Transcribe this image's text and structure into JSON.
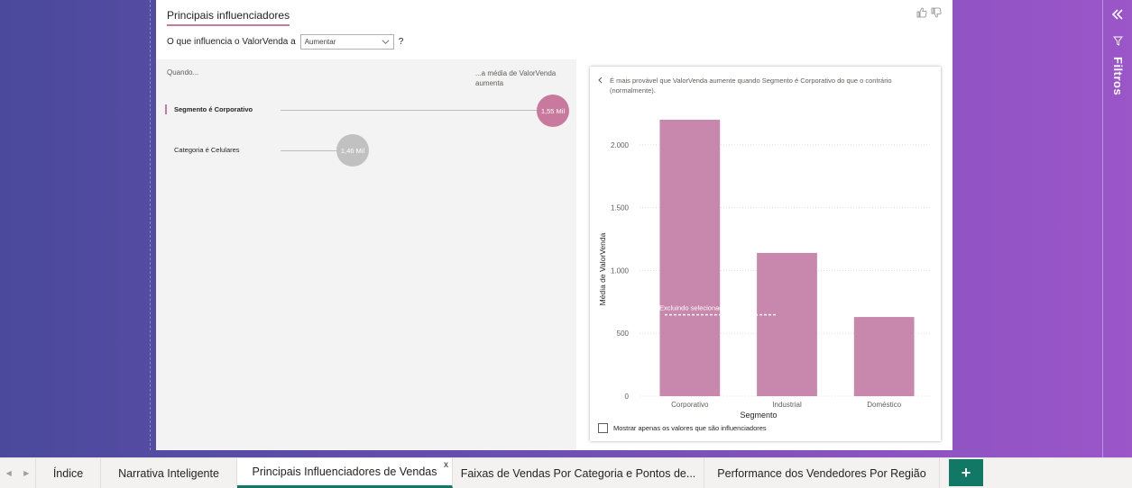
{
  "visual": {
    "title": "Principais influenciadores",
    "question_prefix": "O que influencia o ValorVenda a",
    "dropdown_value": "Aumentar",
    "question_suffix": "?"
  },
  "left_panel": {
    "header_left": "Quando...",
    "header_right": "...a média de ValorVenda aumenta",
    "influencers": [
      {
        "label": "Segmento é Corporativo",
        "value": "1,55 Mil",
        "selected": true,
        "color": "#c8799d"
      },
      {
        "label": "Categoria é Celulares",
        "value": "1,46 Mil",
        "selected": false,
        "color": "#c1c1c1"
      }
    ]
  },
  "right_panel": {
    "explanation": "É mais provável que ValorVenda aumente quando Segmento é Corporativo do que o contrário (normalmente).",
    "checkbox_label": "Mostrar apenas os valores que são influenciadores"
  },
  "chart_data": {
    "type": "bar",
    "categories": [
      "Corporativo",
      "Industrial",
      "Doméstico"
    ],
    "values": [
      2200,
      1140,
      630
    ],
    "xlabel": "Segmento",
    "ylabel": "Média de ValorVenda",
    "yticks": [
      "0",
      "500",
      "1.000",
      "1.500",
      "2.000"
    ],
    "ytick_values": [
      0,
      500,
      1000,
      1500,
      2000
    ],
    "ylim": [
      0,
      2250
    ],
    "reference_line": {
      "label": "Excluindo selecionado: 647,49",
      "value": 647.49
    },
    "bar_color": "#c887ac",
    "grid": true
  },
  "filters": {
    "label": "Filtros"
  },
  "tabs": [
    {
      "label": "Índice",
      "active": false
    },
    {
      "label": "Narrativa Inteligente",
      "active": false
    },
    {
      "label": "Principais Influenciadores de Vendas",
      "active": true
    },
    {
      "label": "Faixas de Vendas Por Categoria e Pontos de...",
      "active": false
    },
    {
      "label": "Performance dos Vendedores Por Região",
      "active": false
    }
  ],
  "tab_close": "x",
  "add_tab": "+"
}
